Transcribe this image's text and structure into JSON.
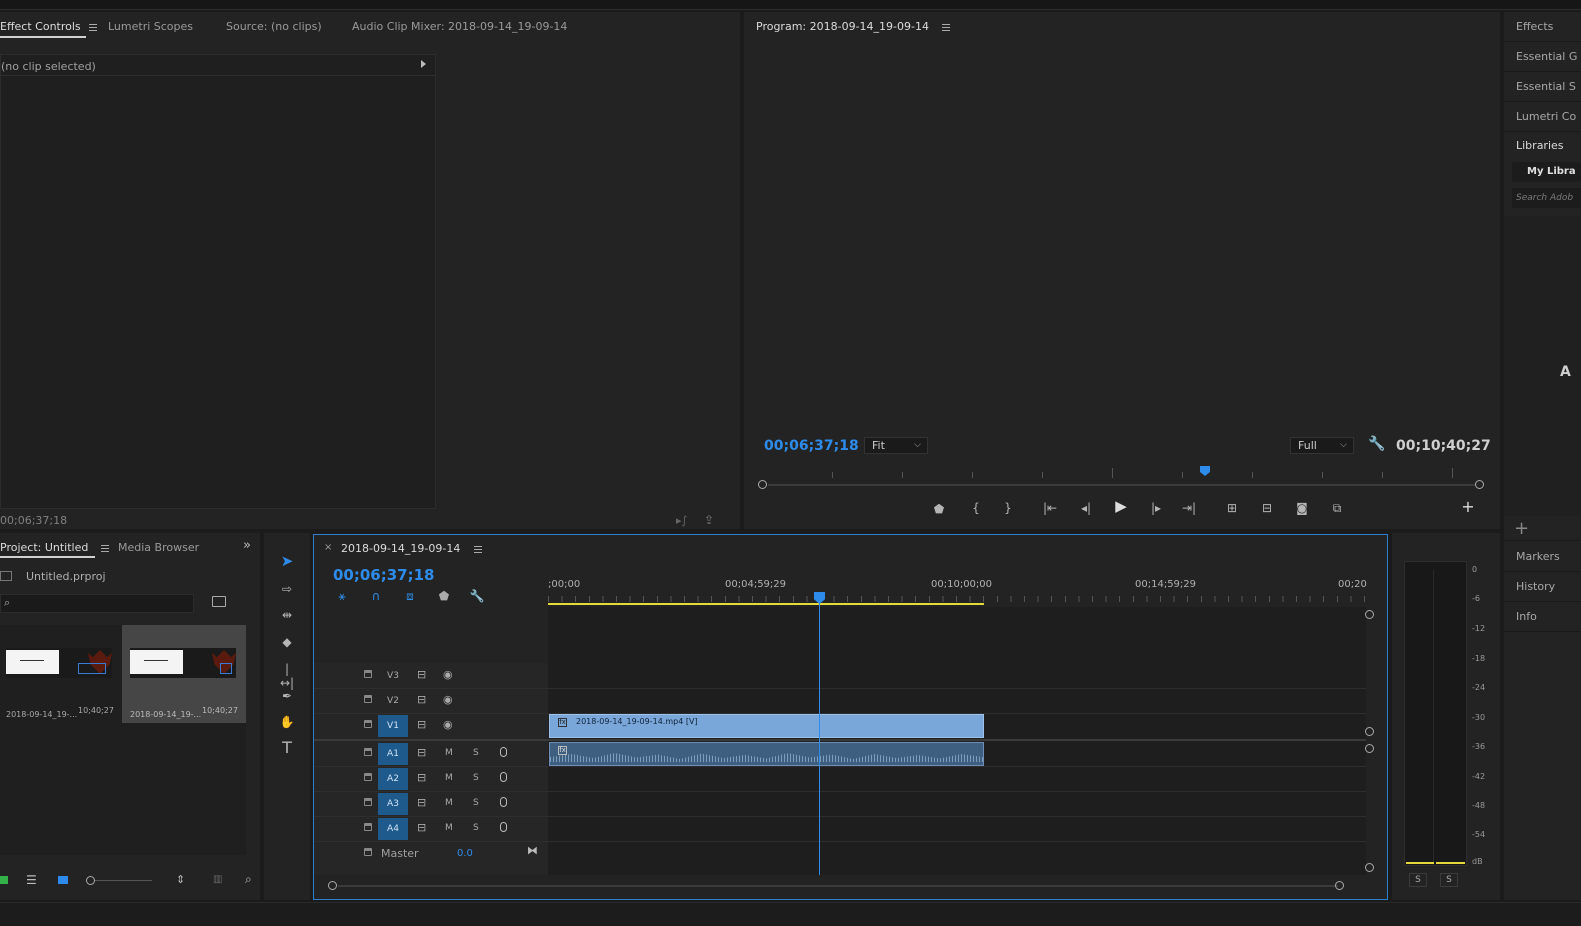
{
  "colors": {
    "accent": "#2d8ceb",
    "clip_video": "#7aa7d9",
    "clip_audio": "#3e5f80",
    "workarea": "#e3d93b",
    "playhead": "#2d8ceb"
  },
  "effect_controls": {
    "tabs": [
      "Effect Controls",
      "Lumetri Scopes",
      "Source: (no clips)",
      "Audio Clip Mixer: 2018-09-14_19-09-14"
    ],
    "no_clip": "(no clip selected)",
    "timecode": "00;06;37;18"
  },
  "program": {
    "title": "Program: 2018-09-14_19-09-14",
    "timecode": "00;06;37;18",
    "fit": "Fit",
    "resolution": "Full",
    "duration": "00;10;40;27",
    "playhead_progress": 0.61,
    "controls": [
      "add-marker",
      "mark-in",
      "mark-out",
      "go-to-in",
      "step-back",
      "play",
      "step-forward",
      "go-to-out",
      "lift",
      "extract",
      "export-frame",
      "comparison-view",
      "add-button"
    ]
  },
  "right_panel": {
    "items": [
      "Effects",
      "Essential G",
      "Essential S",
      "Lumetri Co",
      "Libraries"
    ],
    "library_name": "My Libra",
    "search_placeholder": "Search Adob",
    "letter": "A",
    "lower_items": [
      "Markers",
      "History",
      "Info"
    ]
  },
  "project": {
    "tabs": [
      "Project: Untitled",
      "Media Browser"
    ],
    "file": "Untitled.prproj",
    "items": [
      {
        "name": "2018-09-14_19-...",
        "duration": "10;40;27"
      },
      {
        "name": "2018-09-14_19-...",
        "duration": "10;40;27"
      }
    ]
  },
  "timeline": {
    "sequence": "2018-09-14_19-09-14",
    "close": "×",
    "timecode": "00;06;37;18",
    "ruler": [
      ";00;00",
      "00;04;59;29",
      "00;10;00;00",
      "00;14;59;29",
      "00;20"
    ],
    "playhead_fraction": 0.33,
    "video_tracks": [
      "V3",
      "V2",
      "V1"
    ],
    "audio_tracks": [
      "A1",
      "A2",
      "A3",
      "A4"
    ],
    "mute": "M",
    "solo": "S",
    "master_label": "Master",
    "master_value": "0.0",
    "clip_name": "2018-09-14_19-09-14.mp4 [V]"
  },
  "audio_meter": {
    "ticks": [
      "0",
      "-6",
      "-12",
      "-18",
      "-24",
      "-30",
      "-36",
      "-42",
      "-48",
      "-54",
      "dB"
    ],
    "solo_buttons": [
      "S",
      "S"
    ]
  }
}
